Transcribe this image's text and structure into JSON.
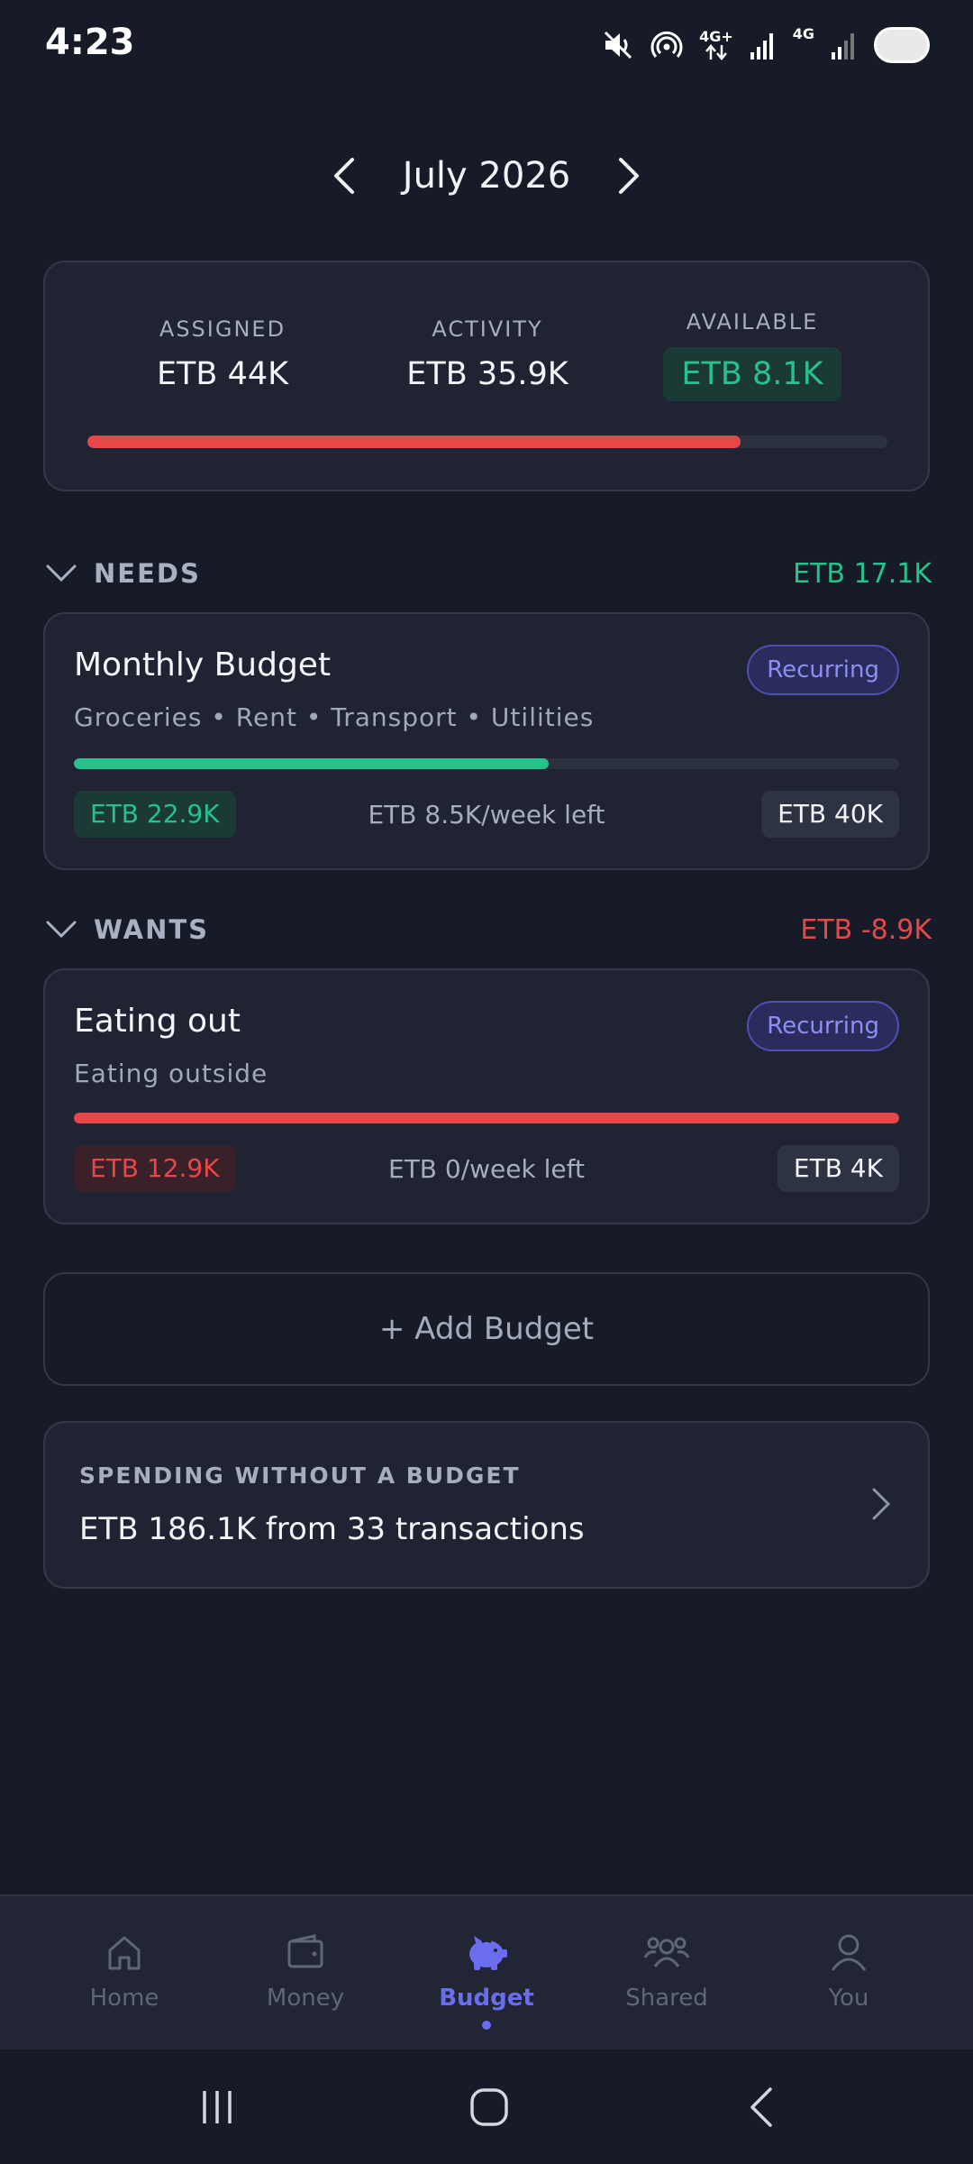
{
  "status_bar": {
    "time": "4:23",
    "network_1": "4G+",
    "network_2": "4G"
  },
  "month_nav": {
    "title": "July 2026"
  },
  "summary": {
    "assigned_label": "ASSIGNED",
    "assigned_value": "ETB 44K",
    "activity_label": "ACTIVITY",
    "activity_value": "ETB 35.9K",
    "available_label": "AVAILABLE",
    "available_value": "ETB 8.1K",
    "spent_fraction": 0.816
  },
  "needs": {
    "title": "NEEDS",
    "amount": "ETB 17.1K",
    "card": {
      "name": "Monthly Budget",
      "badge": "Recurring",
      "description": "Groceries • Rent • Transport • Utilities",
      "progress_fraction": 0.575,
      "spent": "ETB 22.9K",
      "left_text": "ETB 8.5K/week left",
      "limit": "ETB 40K"
    }
  },
  "wants": {
    "title": "WANTS",
    "amount": "ETB -8.9K",
    "card": {
      "name": "Eating out",
      "badge": "Recurring",
      "description": "Eating outside",
      "progress_fraction": 1.0,
      "spent": "ETB 12.9K",
      "left_text": "ETB 0/week left",
      "limit": "ETB 4K"
    }
  },
  "add_budget_label": "+ Add Budget",
  "unbudgeted": {
    "label": "SPENDING WITHOUT A BUDGET",
    "value": "ETB 186.1K from 33 transactions"
  },
  "bottom_nav": {
    "items": [
      {
        "label": "Home",
        "icon": "home-icon"
      },
      {
        "label": "Money",
        "icon": "wallet-icon"
      },
      {
        "label": "Budget",
        "icon": "piggy-bank-icon"
      },
      {
        "label": "Shared",
        "icon": "people-icon"
      },
      {
        "label": "You",
        "icon": "user-icon"
      }
    ],
    "active": "Budget"
  },
  "colors": {
    "background": "#171b27",
    "card": "#1f2332",
    "accent": "#6b6df0",
    "positive": "#27c28b",
    "negative": "#e8474a"
  }
}
